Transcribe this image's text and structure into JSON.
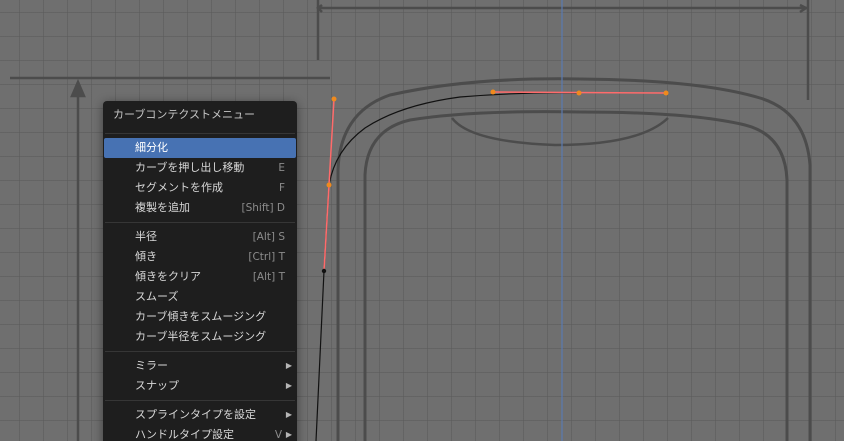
{
  "context_menu": {
    "title": "カーブコンテクストメニュー",
    "groups": [
      [
        {
          "label": "細分化",
          "shortcut": "",
          "submenu": false,
          "active": true
        },
        {
          "label": "カーブを押し出し移動",
          "shortcut": "E",
          "submenu": false,
          "active": false
        },
        {
          "label": "セグメントを作成",
          "shortcut": "F",
          "submenu": false,
          "active": false
        },
        {
          "label": "複製を追加",
          "shortcut": "[Shift] D",
          "submenu": false,
          "active": false
        }
      ],
      [
        {
          "label": "半径",
          "shortcut": "[Alt] S",
          "submenu": false,
          "active": false
        },
        {
          "label": "傾き",
          "shortcut": "[Ctrl] T",
          "submenu": false,
          "active": false
        },
        {
          "label": "傾きをクリア",
          "shortcut": "[Alt] T",
          "submenu": false,
          "active": false
        },
        {
          "label": "スムーズ",
          "shortcut": "",
          "submenu": false,
          "active": false
        },
        {
          "label": "カーブ傾きをスムージング",
          "shortcut": "",
          "submenu": false,
          "active": false
        },
        {
          "label": "カーブ半径をスムージング",
          "shortcut": "",
          "submenu": false,
          "active": false
        }
      ],
      [
        {
          "label": "ミラー",
          "shortcut": "",
          "submenu": true,
          "active": false
        },
        {
          "label": "スナップ",
          "shortcut": "",
          "submenu": true,
          "active": false
        }
      ],
      [
        {
          "label": "スプラインタイプを設定",
          "shortcut": "",
          "submenu": true,
          "active": false
        },
        {
          "label": "ハンドルタイプ設定",
          "shortcut": "V",
          "submenu": true,
          "active": false
        }
      ]
    ]
  },
  "colors": {
    "viewport_bg": "#6f6f6f",
    "menu_bg": "#1e1e1e",
    "highlight": "#4772b3",
    "handle_line": "#ff6b6b",
    "handle_point": "#f08a1d",
    "y_axis": "#5a7ab0"
  },
  "icons": {
    "submenu_arrow": "triangle-right"
  }
}
